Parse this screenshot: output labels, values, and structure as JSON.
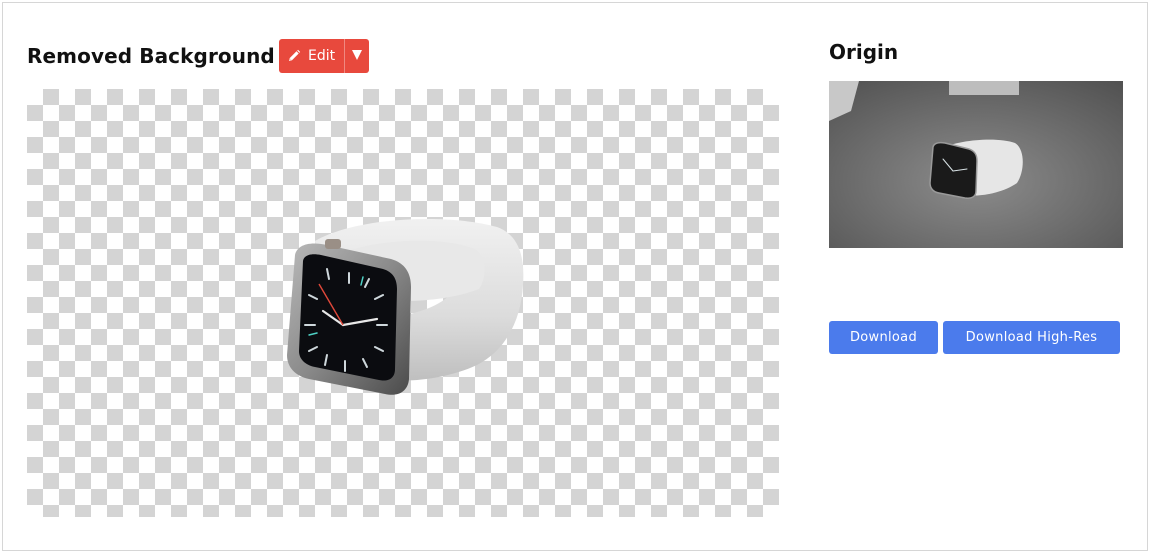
{
  "left_panel": {
    "title": "Removed Background",
    "edit_label": "Edit",
    "edit_icon": "pencil-icon",
    "dropdown_icon": "caret-down-icon"
  },
  "right_panel": {
    "title": "Origin",
    "download_label": "Download",
    "download_hr_label": "Download High-Res"
  },
  "colors": {
    "edit_button": "#e8493d",
    "download_button": "#4b7bec",
    "checker": "#d4d4d4"
  }
}
